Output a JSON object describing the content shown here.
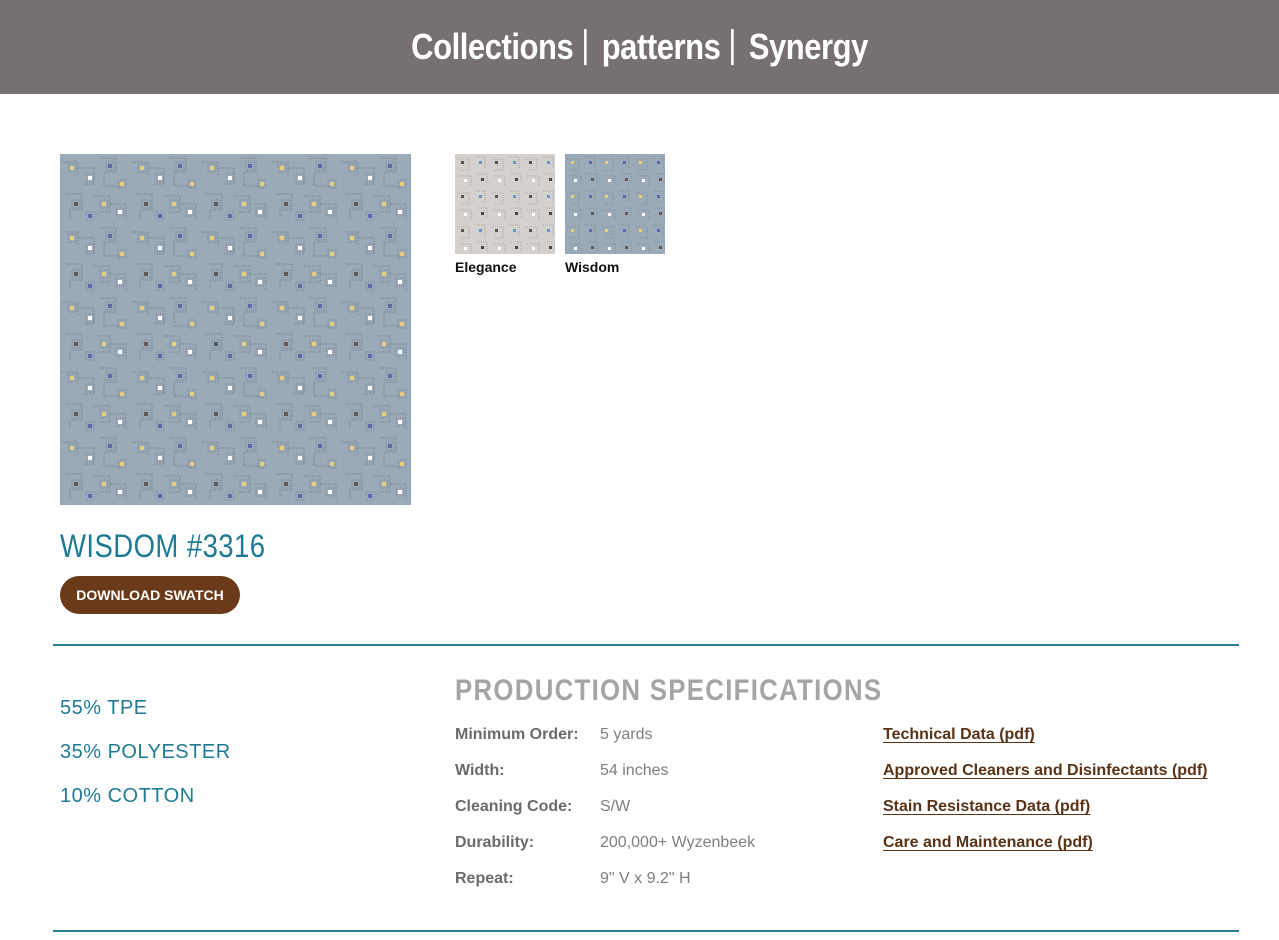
{
  "breadcrumb": {
    "items": [
      {
        "label": "Collections"
      },
      {
        "label": "patterns"
      },
      {
        "label": "Synergy"
      }
    ]
  },
  "product": {
    "title": "WISDOM #3316",
    "download_label": "DOWNLOAD SWATCH"
  },
  "colorways": [
    {
      "label": "Elegance"
    },
    {
      "label": "Wisdom"
    }
  ],
  "composition": [
    "55% TPE",
    "35% POLYESTER",
    "10% COTTON"
  ],
  "specifications": {
    "title": "PRODUCTION SPECIFICATIONS",
    "rows": [
      {
        "label": "Minimum Order:",
        "value": "5 yards"
      },
      {
        "label": "Width:",
        "value": "54 inches"
      },
      {
        "label": "Cleaning Code:",
        "value": "S/W"
      },
      {
        "label": "Durability:",
        "value": "200,000+ Wyzenbeek"
      },
      {
        "label": "Repeat:",
        "value": "9\" V x 9.2\" H"
      }
    ]
  },
  "documents": [
    {
      "label": "Technical Data (pdf)"
    },
    {
      "label": "Approved Cleaners and Disinfectants (pdf)"
    },
    {
      "label": "Stain Resistance Data (pdf)"
    },
    {
      "label": "Care and Maintenance (pdf)"
    }
  ],
  "colors": {
    "header_bg": "#767170",
    "accent_teal": "#1f7a94",
    "button_brown": "#6b3a1a",
    "wisdom_fabric": "#9aaab8",
    "elegance_fabric": "#d4d0cd"
  }
}
